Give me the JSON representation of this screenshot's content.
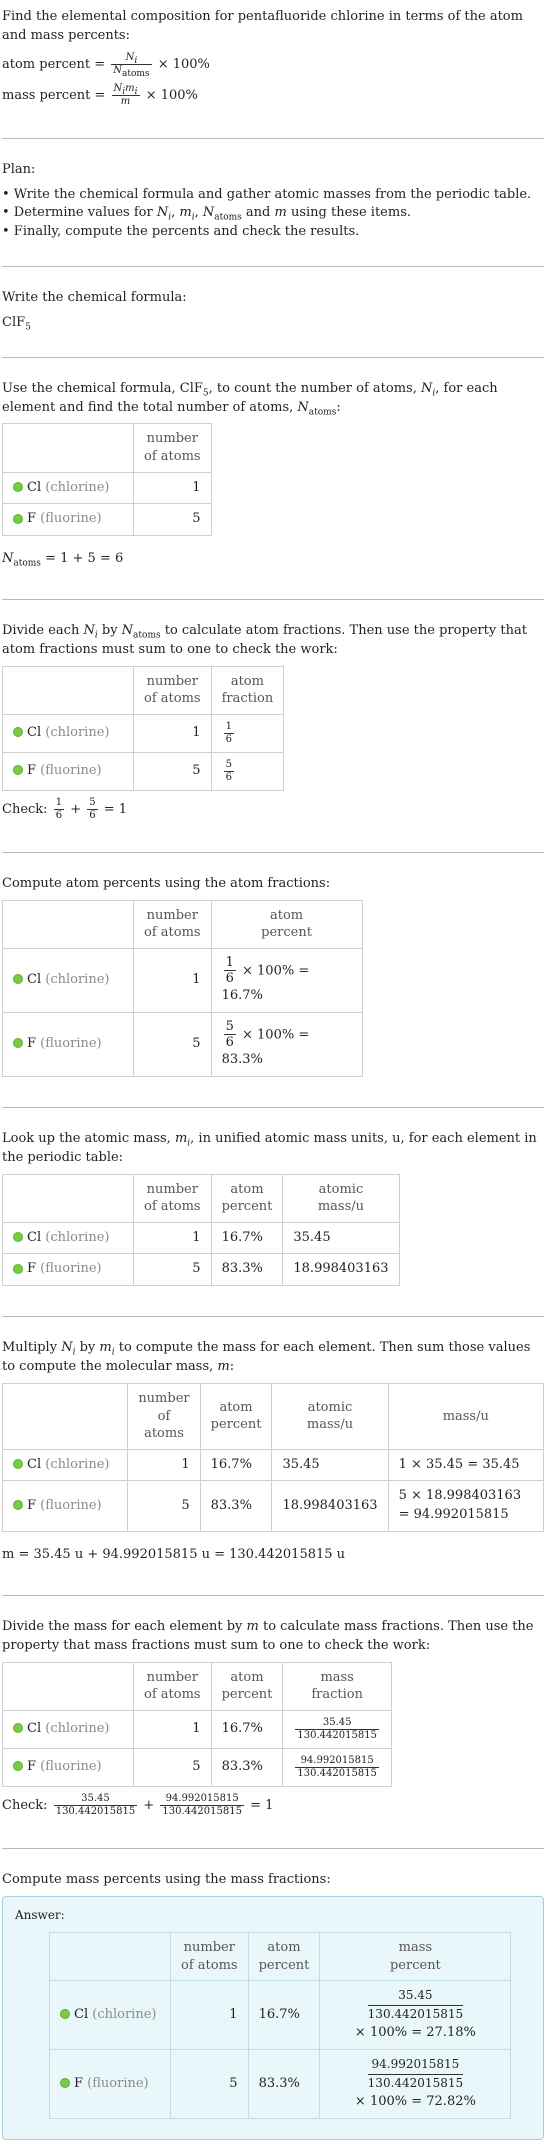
{
  "intro": {
    "question": "Find the elemental composition for pentafluoride chlorine in terms of the atom and mass percents:",
    "atom_percent_label": "atom percent",
    "mass_percent_label": "mass percent",
    "times_100": "× 100%"
  },
  "plan": {
    "title": "Plan:",
    "items": [
      "• Write the chemical formula and gather atomic masses from the periodic table.",
      "• Determine values for N_i, m_i, N_atoms and m using these items.",
      "• Finally, compute the percents and check the results."
    ]
  },
  "formula": {
    "title": "Write the chemical formula:",
    "value": "ClF",
    "subscript": "5"
  },
  "elements": [
    {
      "symbol": "Cl",
      "name": "(chlorine)",
      "atoms": "1",
      "atom_fraction_num": "1",
      "atom_fraction_den": "6",
      "atom_percent": "16.7%",
      "atomic_mass": "35.45",
      "mass_expr": "1 × 35.45 = 35.45",
      "mass": "35.45",
      "mass_percent": "27.18%",
      "color": "#77cc44"
    },
    {
      "symbol": "F",
      "name": "(fluorine)",
      "atoms": "5",
      "atom_fraction_num": "5",
      "atom_fraction_den": "6",
      "atom_percent": "83.3%",
      "atomic_mass": "18.998403163",
      "mass_expr_1": "5 × 18.998403163",
      "mass_expr_2": "= 94.992015815",
      "mass": "94.992015815",
      "mass_percent": "72.82%",
      "color": "#77cc44"
    }
  ],
  "headers": {
    "number_of_atoms": "number of atoms",
    "atom_fraction": "atom fraction",
    "atom_percent": "atom percent",
    "atomic_mass": "atomic mass/u",
    "mass": "mass/u",
    "mass_fraction": "mass fraction",
    "mass_percent": "mass percent"
  },
  "step_count": {
    "text": "Use the chemical formula, ClF5, to count the number of atoms, N_i, for each element and find the total number of atoms, N_atoms:",
    "result": "= 1 + 5 = 6"
  },
  "step_fraction": {
    "text": "Divide each N_i by N_atoms to calculate atom fractions. Then use the property that atom fractions must sum to one to check the work:",
    "check": "Check:",
    "check_result": "= 1"
  },
  "step_atom_percent": {
    "text": "Compute atom percents using the atom fractions:",
    "expr_suffix_cl": "× 100% = 16.7%",
    "expr_suffix_f": "× 100% = 83.3%"
  },
  "step_lookup": {
    "text": "Look up the atomic mass, m_i, in unified atomic mass units, u, for each element in the periodic table:"
  },
  "step_multiply": {
    "text": "Multiply N_i by m_i to compute the mass for each element. Then sum those values to compute the molecular mass, m:",
    "result": "m = 35.45 u + 94.992015815 u = 130.442015815 u"
  },
  "step_mass_fraction": {
    "text": "Divide the mass for each element by m to calculate mass fractions. Then use the property that mass fractions must sum to one to check the work:",
    "molecular_mass": "130.442015815",
    "check": "Check:",
    "check_result": "= 1"
  },
  "step_mass_percent": {
    "text": "Compute mass percents using the mass fractions:",
    "answer_label": "Answer:",
    "times_100_cl": "× 100% = 27.18%",
    "times_100_f": "× 100% = 72.82%"
  }
}
